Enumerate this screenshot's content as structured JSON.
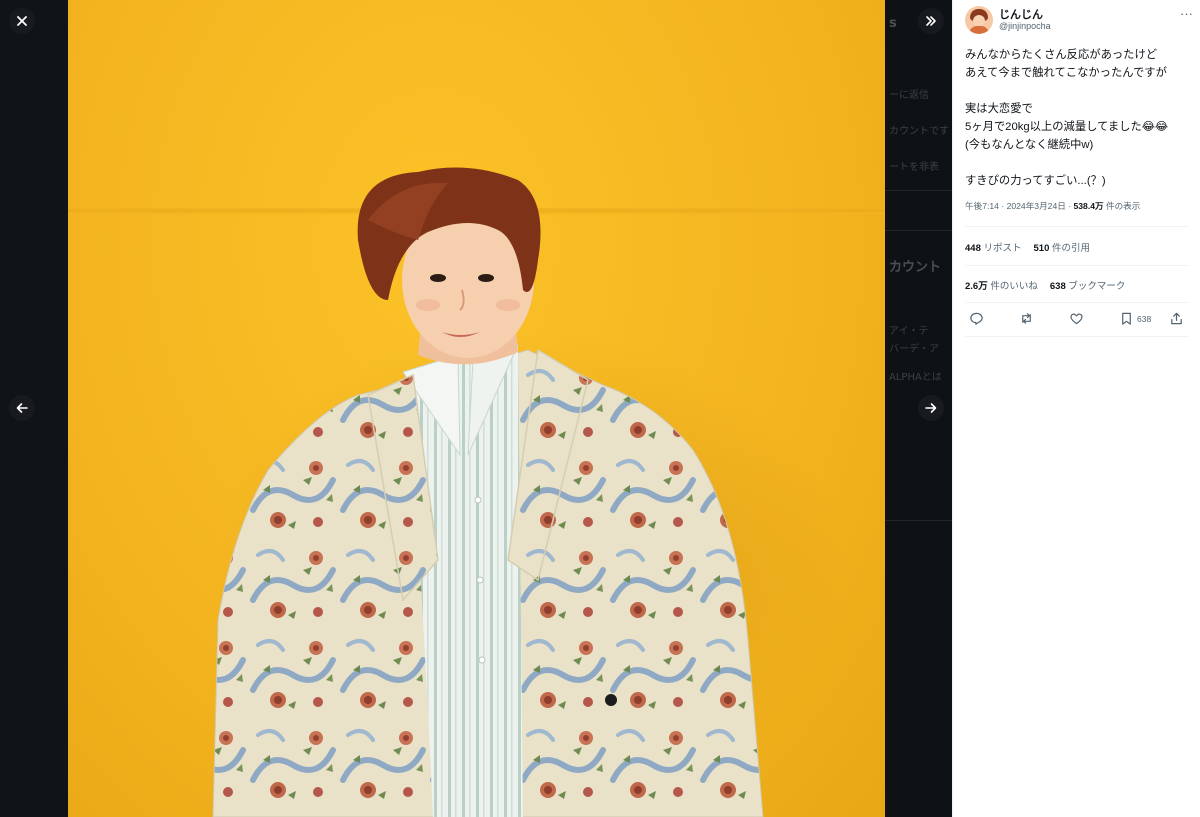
{
  "viewer": {
    "close_label": "✕",
    "expand_label": "»",
    "prev_label": "←",
    "next_label": "→"
  },
  "background_page": {
    "fragments": [
      "s",
      "ーに返信",
      "カウントです",
      "ートを非表",
      "カウント",
      "アイ・テ",
      "バーデ・ア",
      "ALPHAとは"
    ]
  },
  "tweet": {
    "author": {
      "display_name": "じんじん",
      "handle": "@jinjinpocha"
    },
    "more_label": "···",
    "text_lines": [
      "みんなからたくさん反応があったけど",
      "あえて今まで触れてこなかったんですが",
      "",
      "実は大恋愛で",
      "5ヶ月で20kg以上の減量してました😂😂",
      "(今もなんとなく継続中w)",
      "",
      "すきぴの力ってすごい...(？)"
    ],
    "time": "午後7:14",
    "date": "2024年3月24日",
    "separator": "·",
    "views_count": "538.4万",
    "views_label": "件の表示",
    "reposts_count": "448",
    "reposts_label": "リポスト",
    "quotes_count": "510",
    "quotes_label": "件の引用",
    "likes_count": "2.6万",
    "likes_label": "件のいいね",
    "bookmarks_count": "638",
    "bookmarks_label": "ブックマーク",
    "bookmark_action_count": "638"
  },
  "colors": {
    "photo_background": "#f4b520",
    "panel_background": "#ffffff",
    "viewer_background": "#101317",
    "muted_text": "#536471"
  },
  "icons": [
    "close-icon",
    "expand-icon",
    "arrow-left-icon",
    "arrow-right-icon",
    "reply-icon",
    "repost-icon",
    "like-icon",
    "bookmark-icon",
    "share-icon"
  ]
}
